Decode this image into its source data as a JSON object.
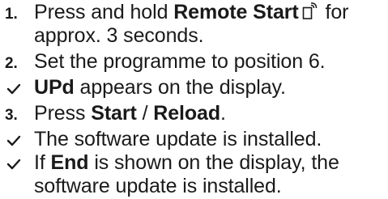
{
  "instructions": {
    "step1": {
      "number": "1.",
      "text_before": "Press and hold ",
      "bold": "Remote Start",
      "icon": "remote-start-icon",
      "text_after": " for approx. 3 seconds."
    },
    "step2": {
      "number": "2.",
      "text": "Set the programme to position 6."
    },
    "result1": {
      "bold": "UPd",
      "text": " appears on the display."
    },
    "step3": {
      "number": "3.",
      "text_before": "Press ",
      "bold1": "Start",
      "separator": " / ",
      "bold2": "Reload",
      "text_after": "."
    },
    "result2": {
      "text": "The software update is installed."
    },
    "result3": {
      "text_before": "If ",
      "bold": "End",
      "text_after": " is shown on the display, the software update is installed."
    }
  }
}
